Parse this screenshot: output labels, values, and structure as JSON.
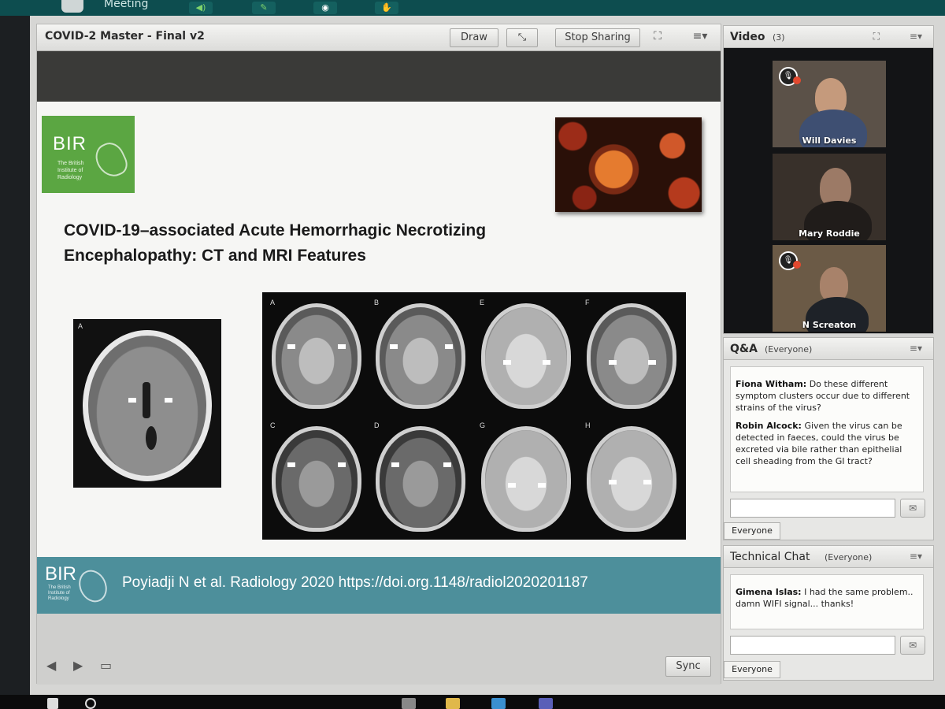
{
  "meeting_bar": {
    "label": "Meeting"
  },
  "share_pod": {
    "title": "COVID-2 Master - Final v2",
    "draw_label": "Draw",
    "stop_sharing_label": "Stop Sharing",
    "sync_label": "Sync"
  },
  "slide": {
    "logo": {
      "letters": "BIR",
      "subtitle": "The British Institute of Radiology"
    },
    "title_line1": "COVID-19–associated Acute Hemorrhagic Necrotizing",
    "title_line2": "Encephalopathy: CT and MRI Features",
    "panel_letters": [
      "A",
      "A",
      "B",
      "E",
      "F",
      "C",
      "D",
      "G",
      "H"
    ],
    "citation": "Poyiadji N et al. Radiology 2020 https://doi.org.1148/radiol2020201187",
    "footer_logo": "BIR",
    "footer_logo_subtitle": "The British Institute of Radiology"
  },
  "video_pod": {
    "title": "Video",
    "count": "(3)",
    "participants": [
      {
        "name": "Will Davies",
        "muted": true
      },
      {
        "name": "Mary Roddie",
        "muted": false
      },
      {
        "name": "N Screaton",
        "muted": true
      }
    ]
  },
  "qa_pod": {
    "title": "Q&A",
    "audience": "(Everyone)",
    "messages": [
      {
        "author": "Fiona Witham:",
        "text": "Do these different symptom clusters occur due to different strains of the virus?"
      },
      {
        "author": "Robin Alcock:",
        "text": "Given the virus can be detected in faeces, could the virus be excreted via bile rather than epithelial cell sheading from the GI tract?"
      }
    ],
    "to_label": "Everyone"
  },
  "tech_chat_pod": {
    "title": "Technical Chat",
    "audience": "(Everyone)",
    "messages": [
      {
        "author": "Gimena Islas:",
        "text": "I had the same problem.. damn WIFI signal... thanks!"
      }
    ],
    "to_label": "Everyone"
  },
  "colors": {
    "bir_green": "#5ba642",
    "bir_teal_footer": "#4d8f9b",
    "muted_mic": "#e2492f",
    "meeting_bar": "#0d4d4f"
  },
  "icons": [
    "speaker-icon",
    "mic-icon",
    "webcam-icon",
    "raise-hand-icon",
    "draw-cursor-icon",
    "fullscreen-icon",
    "menu-icon",
    "arrow-left-icon",
    "arrow-right-icon",
    "sidebar-toggle-icon",
    "send-icon",
    "muted-mic-icon"
  ]
}
